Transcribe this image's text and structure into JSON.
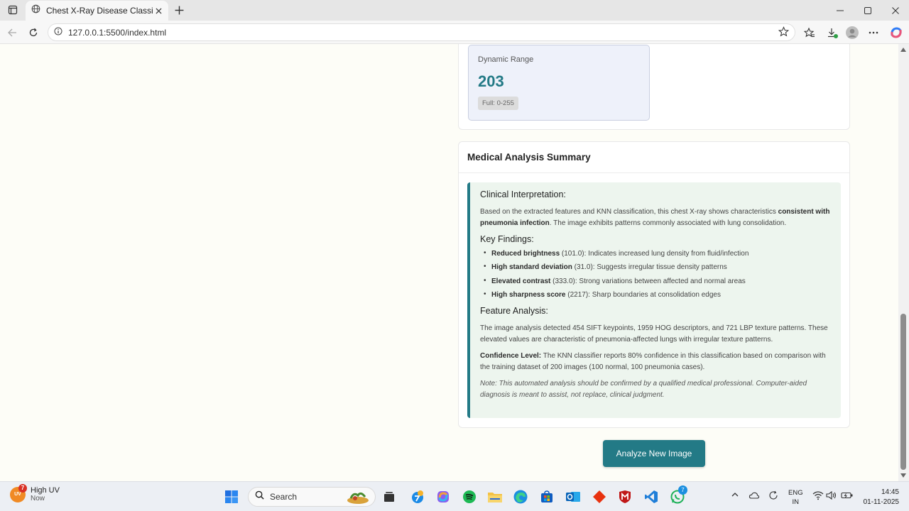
{
  "browser": {
    "tab_title": "Chest X-Ray Disease Classifier",
    "url": "127.0.0.1:5500/index.html"
  },
  "metric": {
    "label": "Dynamic Range",
    "value": "203",
    "range_pill": "Full: 0-255"
  },
  "summary": {
    "heading": "Medical Analysis Summary",
    "clinical_title": "Clinical Interpretation:",
    "clinical_p1_pre": "Based on the extracted features and KNN classification, this chest X-ray shows characteristics ",
    "clinical_p1_bold": "consistent with pneumonia infection",
    "clinical_p1_post": ". The image exhibits patterns commonly associated with lung consolidation.",
    "key_findings_title": "Key Findings:",
    "findings": [
      {
        "bold": "Reduced brightness",
        "text": " (101.0): Indicates increased lung density from fluid/infection"
      },
      {
        "bold": "High standard deviation",
        "text": " (31.0): Suggests irregular tissue density patterns"
      },
      {
        "bold": "Elevated contrast",
        "text": " (333.0): Strong variations between affected and normal areas"
      },
      {
        "bold": "High sharpness score",
        "text": " (2217): Sharp boundaries at consolidation edges"
      }
    ],
    "feature_title": "Feature Analysis:",
    "feature_p": "The image analysis detected 454 SIFT keypoints, 1959 HOG descriptors, and 721 LBP texture patterns. These elevated values are characteristic of pneumonia-affected lungs with irregular texture patterns.",
    "confidence_bold": "Confidence Level:",
    "confidence_text": " The KNN classifier reports 80% confidence in this classification based on comparison with the training dataset of 200 images (100 normal, 100 pneumonia cases).",
    "note": "Note: This automated analysis should be confirmed by a qualified medical professional. Computer-aided diagnosis is meant to assist, not replace, clinical judgment."
  },
  "analyze_button": "Analyze New Image",
  "taskbar": {
    "weather_badge": "7",
    "weather_sun": "UV",
    "weather_title": "High UV",
    "weather_sub": "Now",
    "search_label": "Search",
    "lang_line1": "ENG",
    "lang_line2": "IN",
    "time": "14:45",
    "date": "01-11-2025",
    "whatsapp_badge": "7"
  },
  "colors": {
    "accent": "#237a86",
    "clinical_bg": "#edf5ee",
    "metric_bg": "#eef1fa"
  }
}
